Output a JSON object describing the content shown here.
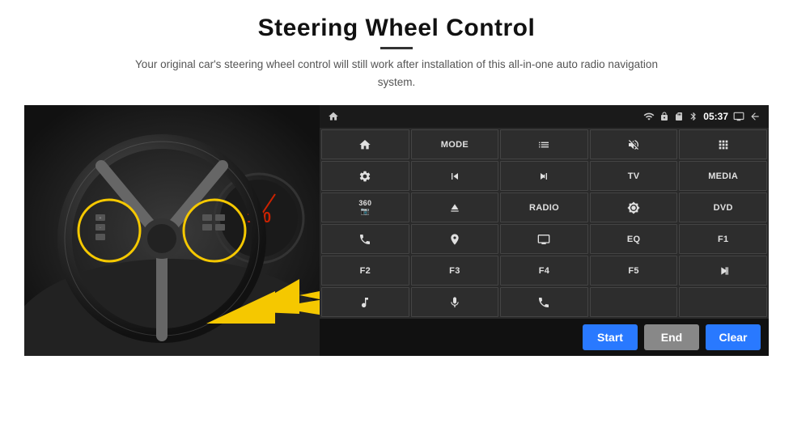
{
  "page": {
    "title": "Steering Wheel Control",
    "subtitle": "Your original car's steering wheel control will still work after installation of this all-in-one auto radio navigation system."
  },
  "statusBar": {
    "time": "05:37",
    "icons": [
      "wifi",
      "lock",
      "sd",
      "bluetooth",
      "screen",
      "back"
    ]
  },
  "grid": [
    [
      {
        "type": "icon",
        "icon": "home",
        "label": ""
      },
      {
        "type": "text",
        "label": "MODE"
      },
      {
        "type": "icon",
        "icon": "list",
        "label": ""
      },
      {
        "type": "icon",
        "icon": "mute",
        "label": ""
      },
      {
        "type": "icon",
        "icon": "apps",
        "label": ""
      }
    ],
    [
      {
        "type": "icon",
        "icon": "settings",
        "label": ""
      },
      {
        "type": "icon",
        "icon": "rewind",
        "label": ""
      },
      {
        "type": "icon",
        "icon": "forward",
        "label": ""
      },
      {
        "type": "text",
        "label": "TV"
      },
      {
        "type": "text",
        "label": "MEDIA"
      }
    ],
    [
      {
        "type": "icon",
        "icon": "360cam",
        "label": ""
      },
      {
        "type": "icon",
        "icon": "eject",
        "label": ""
      },
      {
        "type": "text",
        "label": "RADIO"
      },
      {
        "type": "icon",
        "icon": "brightness",
        "label": ""
      },
      {
        "type": "text",
        "label": "DVD"
      }
    ],
    [
      {
        "type": "icon",
        "icon": "phone",
        "label": ""
      },
      {
        "type": "icon",
        "icon": "navigation",
        "label": ""
      },
      {
        "type": "icon",
        "icon": "display",
        "label": ""
      },
      {
        "type": "text",
        "label": "EQ"
      },
      {
        "type": "text",
        "label": "F1"
      }
    ],
    [
      {
        "type": "text",
        "label": "F2"
      },
      {
        "type": "text",
        "label": "F3"
      },
      {
        "type": "text",
        "label": "F4"
      },
      {
        "type": "text",
        "label": "F5"
      },
      {
        "type": "icon",
        "icon": "playpause",
        "label": ""
      }
    ],
    [
      {
        "type": "icon",
        "icon": "music",
        "label": ""
      },
      {
        "type": "icon",
        "icon": "mic",
        "label": ""
      },
      {
        "type": "icon",
        "icon": "callend",
        "label": ""
      },
      {
        "type": "empty",
        "label": ""
      },
      {
        "type": "empty",
        "label": ""
      }
    ]
  ],
  "bottomBar": {
    "startLabel": "Start",
    "endLabel": "End",
    "clearLabel": "Clear"
  }
}
